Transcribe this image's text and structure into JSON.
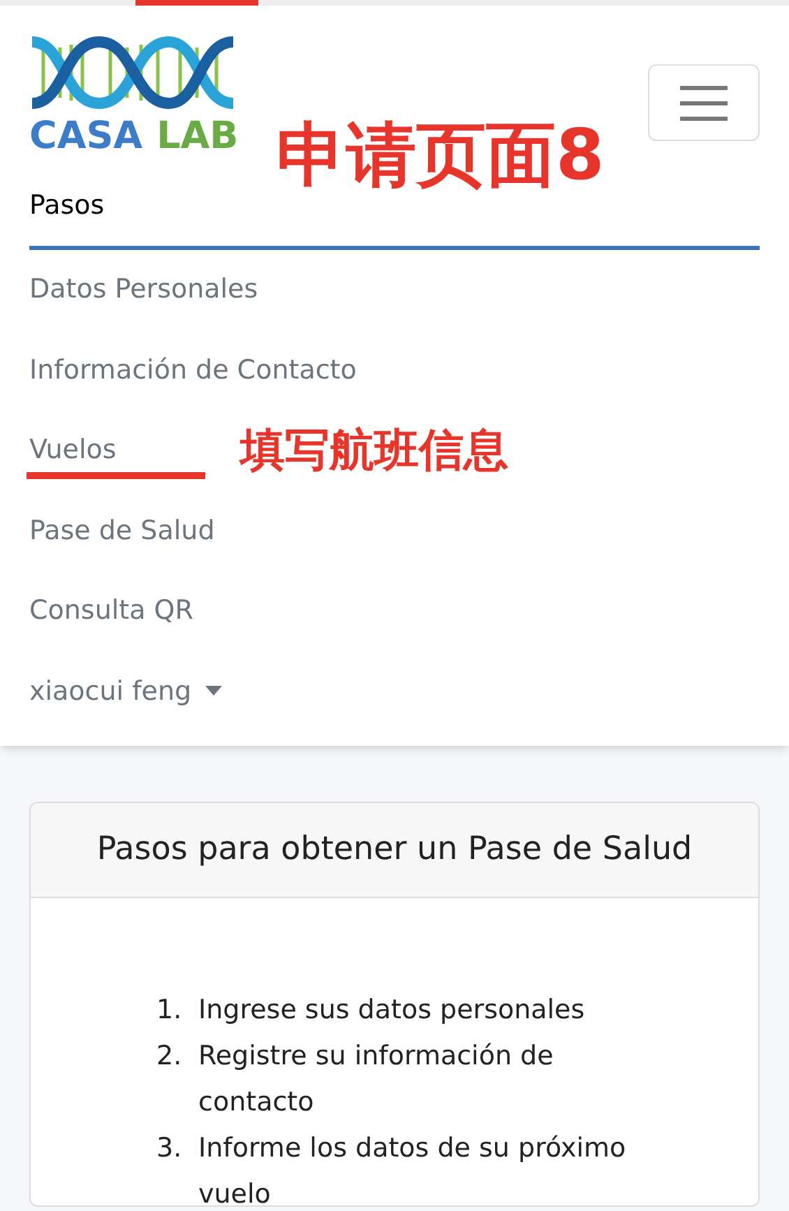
{
  "logo": {
    "word_1": "CASA",
    "word_2": "LAB"
  },
  "annotation_title": "申请页面8",
  "nav": {
    "heading": "Pasos",
    "items": [
      {
        "label": "Datos Personales",
        "kind": "link"
      },
      {
        "label": "Información de Contacto",
        "kind": "link"
      },
      {
        "label": "Vuelos",
        "kind": "link",
        "annotation": "填写航班信息"
      },
      {
        "label": "Pase de Salud",
        "kind": "link"
      },
      {
        "label": "Consulta QR",
        "kind": "link"
      },
      {
        "label": "xiaocui feng",
        "kind": "dropdown"
      }
    ]
  },
  "card": {
    "title": "Pasos para obtener un Pase de Salud",
    "steps": [
      {
        "number": "1.",
        "text": "Ingrese sus datos personales"
      },
      {
        "number": "2.",
        "text": "Registre su información de contacto"
      },
      {
        "number": "3.",
        "text": "Informe los datos de su próximo vuelo"
      }
    ]
  }
}
